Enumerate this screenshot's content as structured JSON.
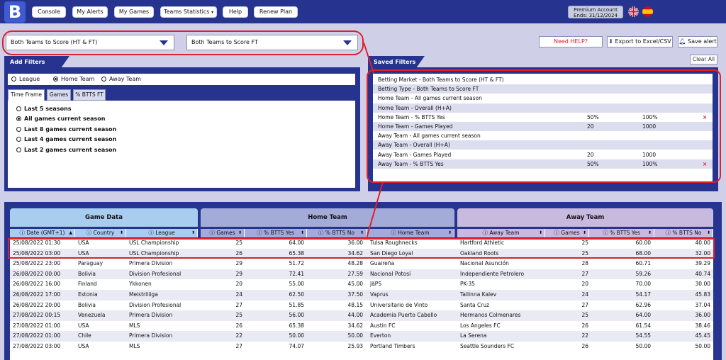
{
  "nav": {
    "logo": "B",
    "items": [
      "Console",
      "My Alerts",
      "My Games",
      "Teams Statistics",
      "Help",
      "Renew Plan"
    ],
    "premium_line1": "Premium Account",
    "premium_line2": "Ends: 31/12/2024"
  },
  "selects": {
    "market": "Both Teams to Score (HT & FT)",
    "type": "Both Teams to Score FT"
  },
  "actions": {
    "help": "Need HELP?",
    "export": "Export to Excel/CSV",
    "save": "Save alert",
    "clear": "Clear All"
  },
  "add_filters": {
    "title": "Add Filters",
    "radios": [
      "League",
      "Home Team",
      "Away Team"
    ],
    "tabs": [
      "Time Frame",
      "Games",
      "% BTTS FT"
    ],
    "options": [
      "Last 5 seasons",
      "All games current season",
      "Last 8 games current season",
      "Last 4 games current season",
      "Last 2 games current season"
    ]
  },
  "saved_filters": {
    "title": "Saved Filters",
    "rows": [
      {
        "label": "Betting Market - Both Teams to Score (HT & FT)",
        "v1": "",
        "v2": "",
        "x": ""
      },
      {
        "label": "Betting Type - Both Teams to Score FT",
        "v1": "",
        "v2": "",
        "x": ""
      },
      {
        "label": "Home Team - All games current season",
        "v1": "",
        "v2": "",
        "x": ""
      },
      {
        "label": "Home Team - Overall (H+A)",
        "v1": "",
        "v2": "",
        "x": ""
      },
      {
        "label": "Home Team - % BTTS Yes",
        "v1": "50%",
        "v2": "100%",
        "x": "×"
      },
      {
        "label": "Home Team - Games Played",
        "v1": "20",
        "v2": "1000",
        "x": ""
      },
      {
        "label": "Away Team - All games current season",
        "v1": "",
        "v2": "",
        "x": ""
      },
      {
        "label": "Away Team - Overall (H+A)",
        "v1": "",
        "v2": "",
        "x": ""
      },
      {
        "label": "Away Team - Games Played",
        "v1": "20",
        "v2": "1000",
        "x": ""
      },
      {
        "label": "Away Team - % BTTS Yes",
        "v1": "50%",
        "v2": "100%",
        "x": "×"
      }
    ]
  },
  "grid": {
    "groups": [
      "Game Data",
      "Home Team",
      "Away Team"
    ],
    "columns": [
      "Date (GMT+1)",
      "Country",
      "League",
      "Games",
      "% BTTS Yes",
      "% BTTS No",
      "Home Team",
      "Away Team",
      "Games",
      "% BTTS Yes",
      "% BTTS No"
    ],
    "rows": [
      [
        "25/08/2022 01:30",
        "USA",
        "USL Championship",
        "25",
        "64.00",
        "36.00",
        "Tulsa Roughnecks",
        "Hartford Athletic",
        "25",
        "60.00",
        "40.00"
      ],
      [
        "25/08/2022 03:00",
        "USA",
        "USL Championship",
        "26",
        "65.38",
        "34.62",
        "San Diego Loyal",
        "Oakland Roots",
        "25",
        "68.00",
        "32.00"
      ],
      [
        "25/08/2022 23:00",
        "Paraguay",
        "Primera Division",
        "29",
        "51.72",
        "48.28",
        "Guaireña",
        "Nacional Asunción",
        "28",
        "60.71",
        "39.29"
      ],
      [
        "26/08/2022 00:00",
        "Bolivia",
        "Division Profesional",
        "29",
        "72.41",
        "27.59",
        "Nacional Potosí",
        "Independiente Petrolero",
        "27",
        "59.26",
        "40.74"
      ],
      [
        "26/08/2022 16:00",
        "Finland",
        "Ykkonen",
        "20",
        "55.00",
        "45.00",
        "JäPS",
        "PK-35",
        "20",
        "70.00",
        "30.00"
      ],
      [
        "26/08/2022 17:00",
        "Estonia",
        "Meistriliiga",
        "24",
        "62.50",
        "37.50",
        "Vaprus",
        "Tallinna Kalev",
        "24",
        "54.17",
        "45.83"
      ],
      [
        "26/08/2022 20:00",
        "Bolivia",
        "Division Profesional",
        "27",
        "51.85",
        "48.15",
        "Universitario de Vinto",
        "Santa Cruz",
        "27",
        "62.96",
        "37.04"
      ],
      [
        "27/08/2022 00:15",
        "Venezuela",
        "Primera Division",
        "25",
        "56.00",
        "44.00",
        "Academia Puerto Cabello",
        "Hermanos Colmenares",
        "25",
        "64.00",
        "36.00"
      ],
      [
        "27/08/2022 01:00",
        "USA",
        "MLS",
        "26",
        "65.38",
        "34.62",
        "Austin FC",
        "Los Angeles FC",
        "26",
        "61.54",
        "38.46"
      ],
      [
        "27/08/2022 01:00",
        "Chile",
        "Primera Division",
        "22",
        "50.00",
        "50.00",
        "Everton",
        "La Serena",
        "22",
        "54.55",
        "45.45"
      ],
      [
        "27/08/2022 03:00",
        "USA",
        "MLS",
        "27",
        "74.07",
        "25.93",
        "Portland Timbers",
        "Seattle Sounders FC",
        "26",
        "50.00",
        "50.00"
      ]
    ]
  }
}
